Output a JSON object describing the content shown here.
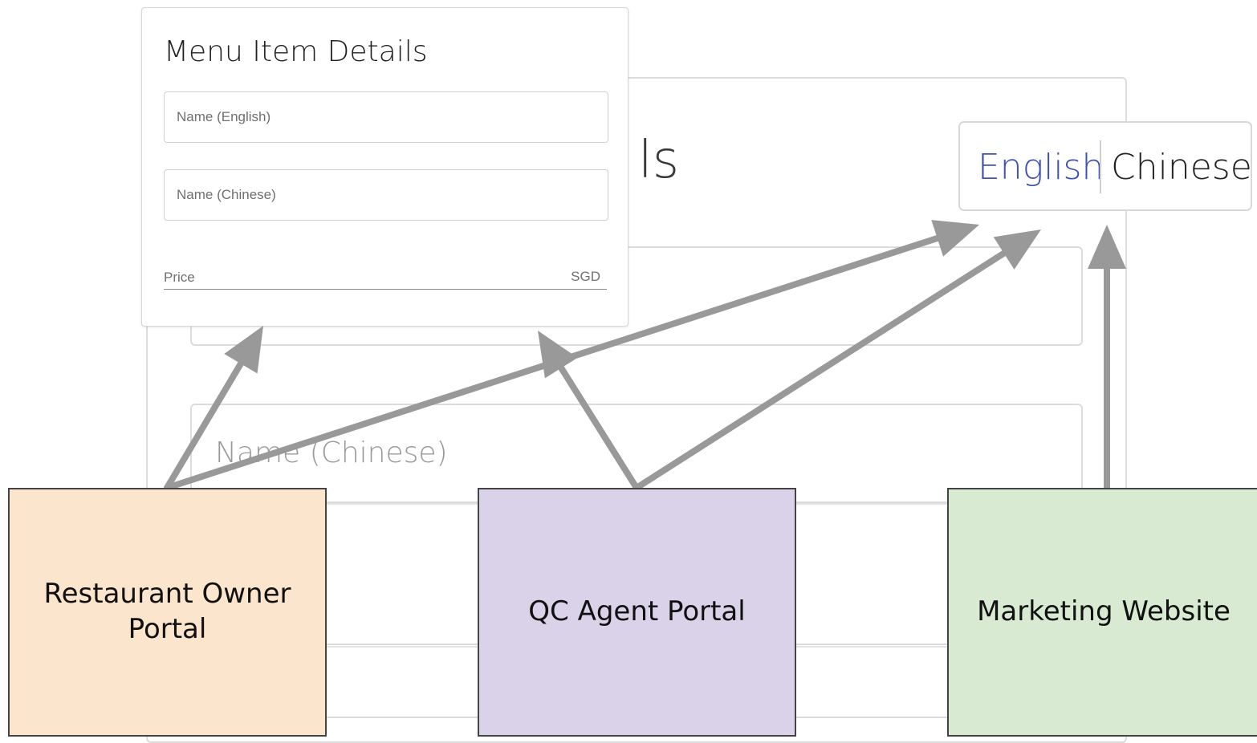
{
  "background_form": {
    "title_fragment": "ls",
    "field_label": "Name (Chinese)"
  },
  "menu_card": {
    "title": "Menu Item Details",
    "name_english_placeholder": "Name (English)",
    "name_chinese_placeholder": "Name (Chinese)",
    "price_label": "Price",
    "price_currency": "SGD"
  },
  "language_toggle": {
    "english": "English",
    "chinese": "Chinese",
    "active": "English",
    "active_color": "#3f51b5"
  },
  "portals": {
    "owner": {
      "label": "Restaurant Owner Portal",
      "color": "#fce5cd"
    },
    "qc": {
      "label": "QC Agent Portal",
      "color": "#d9d2e9"
    },
    "marketing": {
      "label": "Marketing Website",
      "color": "#d9ead3"
    }
  },
  "connections": [
    {
      "from": "Restaurant Owner Portal",
      "to": "Menu Item Details"
    },
    {
      "from": "Restaurant Owner Portal",
      "to": "Language Toggle"
    },
    {
      "from": "QC Agent Portal",
      "to": "Menu Item Details"
    },
    {
      "from": "QC Agent Portal",
      "to": "Language Toggle"
    },
    {
      "from": "Marketing Website",
      "to": "Language Toggle"
    }
  ],
  "arrow_color": "#999999"
}
